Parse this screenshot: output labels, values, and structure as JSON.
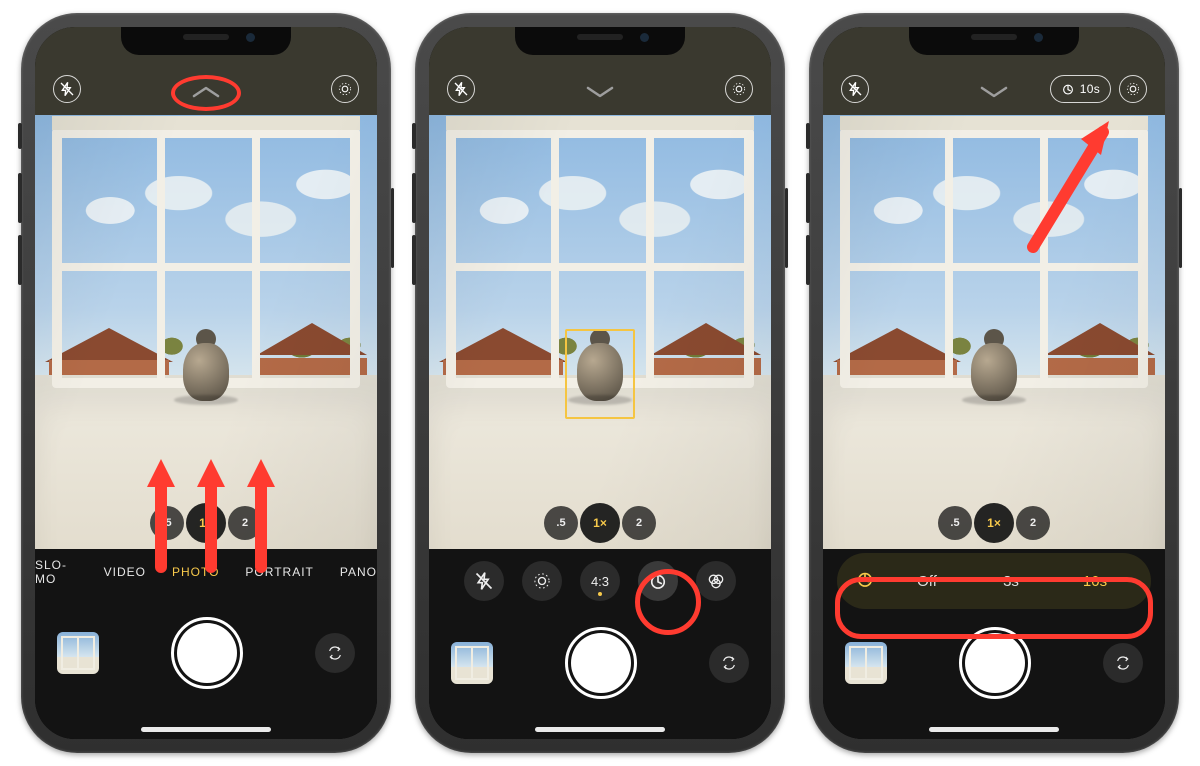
{
  "zoom": {
    "half": ".5",
    "one": "1×",
    "two": "2"
  },
  "screen1": {
    "topbar": {
      "chevron_dir": "up"
    },
    "modes": [
      "SLO-MO",
      "VIDEO",
      "PHOTO",
      "PORTRAIT",
      "PANO"
    ],
    "selected_mode_index": 2
  },
  "screen2": {
    "topbar": {
      "chevron_dir": "down"
    },
    "controls": {
      "aspect_label": "4:3"
    },
    "focus_box": true
  },
  "screen3": {
    "topbar": {
      "chevron_dir": "down",
      "timer_badge": "10s"
    },
    "timer_options": {
      "off": "Off",
      "three": "3s",
      "ten": "10s",
      "selected": "10s"
    }
  }
}
